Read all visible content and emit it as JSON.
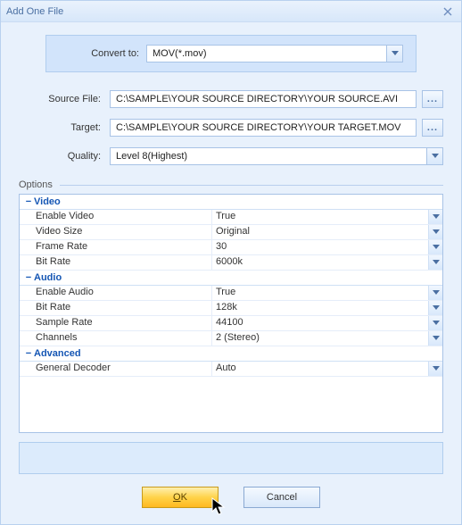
{
  "title": "Add One File",
  "convert": {
    "label": "Convert to:",
    "value": "MOV(*.mov)"
  },
  "fields": {
    "source": {
      "label": "Source File:",
      "value": "C:\\SAMPLE\\YOUR SOURCE DIRECTORY\\YOUR SOURCE.AVI"
    },
    "target": {
      "label": "Target:",
      "value": "C:\\SAMPLE\\YOUR SOURCE DIRECTORY\\YOUR TARGET.MOV"
    },
    "quality": {
      "label": "Quality:",
      "value": "Level 8(Highest)"
    }
  },
  "browse_label": "...",
  "options_label": "Options",
  "sections": {
    "video": {
      "title": "Video",
      "props": [
        {
          "name": "Enable Video",
          "value": "True"
        },
        {
          "name": "Video Size",
          "value": "Original"
        },
        {
          "name": "Frame Rate",
          "value": "30"
        },
        {
          "name": "Bit Rate",
          "value": "6000k"
        }
      ]
    },
    "audio": {
      "title": "Audio",
      "props": [
        {
          "name": "Enable Audio",
          "value": "True"
        },
        {
          "name": "Bit Rate",
          "value": "128k"
        },
        {
          "name": "Sample Rate",
          "value": "44100"
        },
        {
          "name": "Channels",
          "value": "2 (Stereo)"
        }
      ]
    },
    "advanced": {
      "title": "Advanced",
      "props": [
        {
          "name": "General Decoder",
          "value": "Auto"
        }
      ]
    }
  },
  "buttons": {
    "ok_prefix": "O",
    "ok_rest": "K",
    "cancel": "Cancel"
  }
}
